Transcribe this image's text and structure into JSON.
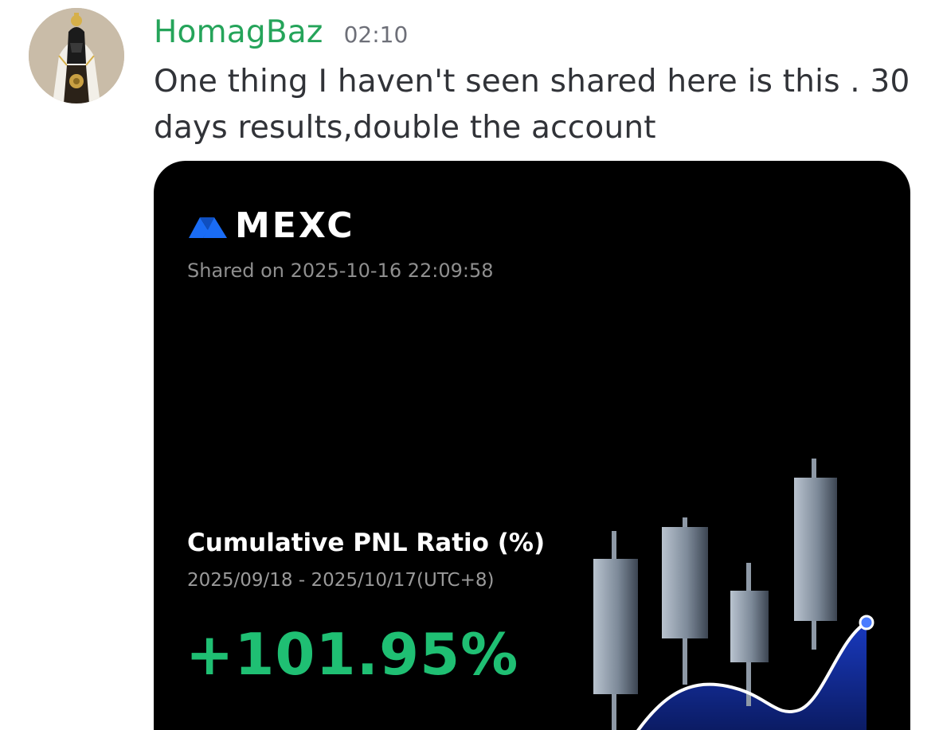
{
  "message": {
    "username": "HomagBaz",
    "timestamp": "02:10",
    "text": "One thing I haven't seen shared here is this . 30 days results,double the account"
  },
  "card": {
    "brand": "MEXC",
    "shared_on": "Shared on 2025-10-16 22:09:58",
    "pnl_title": "Cumulative PNL Ratio (%)",
    "date_range": "2025/09/18 - 2025/10/17(UTC+8)",
    "pnl_value": "+101.95%",
    "colors": {
      "username": "#25a45a",
      "brand_blue": "#1a6cf5",
      "pnl_green": "#1fbf73",
      "card_bg": "#000000"
    }
  }
}
